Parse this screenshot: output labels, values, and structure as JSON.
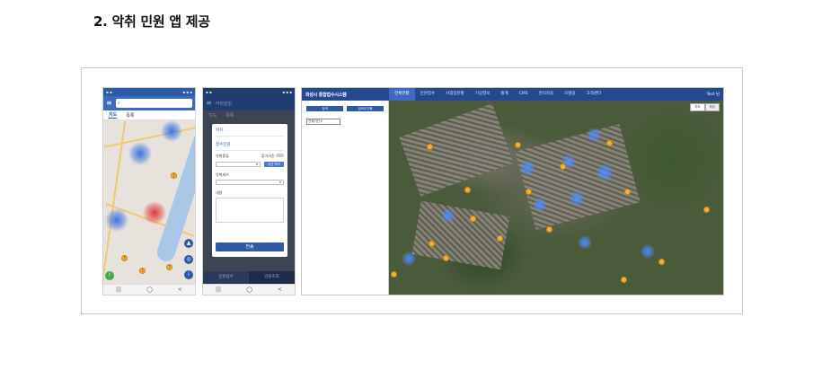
{
  "page": {
    "title": "2. 악취 민원 앱 제공"
  },
  "phone_map": {
    "search_icon": "search-icon",
    "menu_icon": "hamburger-menu-icon",
    "tabs": [
      "지도",
      "목록"
    ],
    "nav": [
      "|||",
      "◯",
      "<"
    ],
    "pins": [
      "7",
      "7",
      "7",
      "7"
    ]
  },
  "phone_form": {
    "header_title": "악취민원",
    "tabs": [
      "지도",
      "목록"
    ],
    "dialog": {
      "location_label": "위치",
      "category_label": "접수민원",
      "type_label": "악취종류",
      "photo_label": "증거사진",
      "photo_button": "사진 찍기",
      "intensity_label": "악취세기",
      "content_label": "내용",
      "submit": "전송"
    },
    "bottom_buttons": [
      "민원접수",
      "민원조회"
    ],
    "nav": [
      "|||",
      "◯",
      "<"
    ]
  },
  "web": {
    "logo": "화성시 통합접수시스템",
    "menu": [
      "전체현황",
      "민원접수",
      "사업장현황",
      "기상정보",
      "통계",
      "CMS",
      "관리자용",
      "모델링",
      "고객센터"
    ],
    "active_menu": "전체현황",
    "user": "Test 님",
    "side_buttons": [
      "검색",
      "검색초기화"
    ],
    "side_select": "전체기간",
    "map_toggle": [
      "지도",
      "위성"
    ]
  },
  "colors": {
    "brand_blue": "#24498f",
    "accent_blue": "#2d5aa6",
    "pin_orange": "#f2b233",
    "alert_red": "#e23a3a"
  }
}
